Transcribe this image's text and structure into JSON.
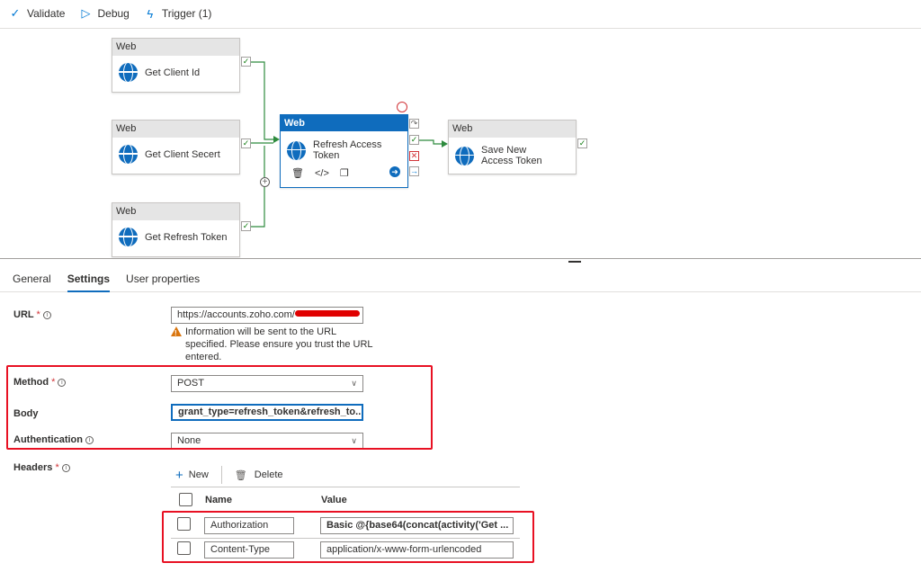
{
  "toolbar": {
    "validate": "Validate",
    "debug": "Debug",
    "trigger": "Trigger (1)"
  },
  "pipeline": {
    "activities": [
      {
        "type": "Web",
        "name": "Get Client Id"
      },
      {
        "type": "Web",
        "name": "Get Client Secert"
      },
      {
        "type": "Web",
        "name": "Get Refresh Token"
      },
      {
        "type": "Web",
        "name": "Refresh Access Token"
      },
      {
        "type": "Web",
        "name": "Save New Access Token"
      }
    ]
  },
  "tabs": [
    "General",
    "Settings",
    "User properties"
  ],
  "active_tab": "Settings",
  "form": {
    "url_label": "URL",
    "url_value": "https://accounts.zoho.com/",
    "url_warning": "Information will be sent to the URL specified. Please ensure you trust the URL entered.",
    "method_label": "Method",
    "method_value": "POST",
    "body_label": "Body",
    "body_value": "grant_type=refresh_token&refresh_to...",
    "auth_label": "Authentication",
    "auth_value": "None",
    "headers_label": "Headers",
    "required_mark": "*"
  },
  "headers": {
    "new_label": "New",
    "delete_label": "Delete",
    "col_name": "Name",
    "col_value": "Value",
    "rows": [
      {
        "name": "Authorization",
        "value": "Basic @{base64(concat(activity('Get ..."
      },
      {
        "name": "Content-Type",
        "value": "application/x-www-form-urlencoded"
      }
    ]
  },
  "colors": {
    "accent": "#0f6cbd",
    "highlight_box": "#e81123",
    "success": "#107c10"
  }
}
